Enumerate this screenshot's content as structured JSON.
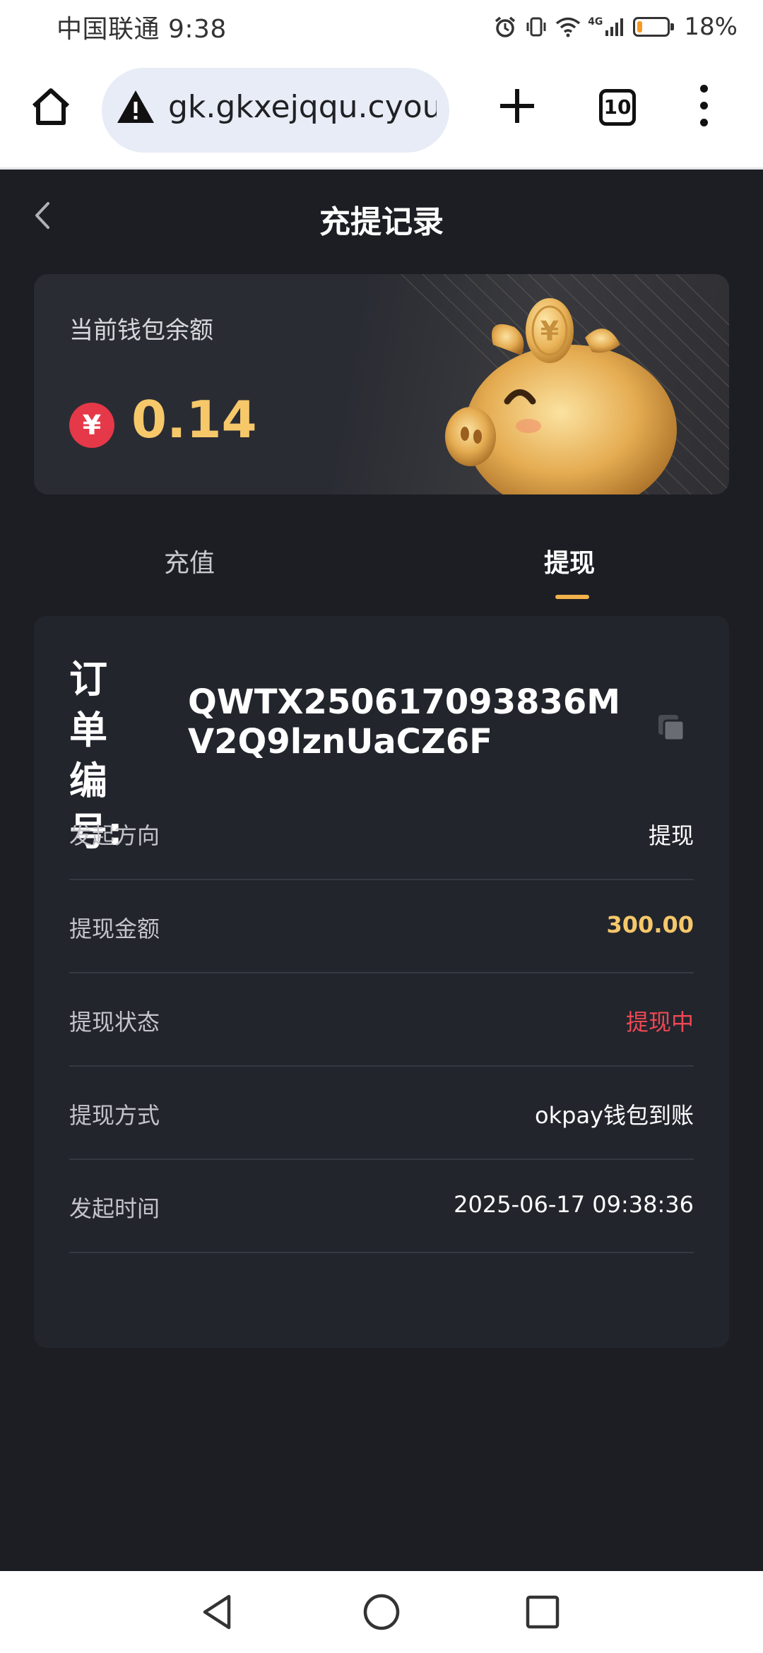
{
  "status_bar": {
    "carrier_time": "中国联通 9:38",
    "network": "4G",
    "battery_percent": "18%",
    "battery_level": 0.18,
    "battery_color": "#f59a23"
  },
  "browser": {
    "url": "gk.gkxejqqu.cyou",
    "tab_count": "10"
  },
  "header": {
    "title": "充提记录"
  },
  "wallet": {
    "label": "当前钱包余额",
    "currency_symbol": "¥",
    "balance": "0.14",
    "accent_color": "#f6c86a"
  },
  "tabs": [
    {
      "label": "充值",
      "active": false
    },
    {
      "label": "提现",
      "active": true
    }
  ],
  "order": {
    "number_label": "订单编号:",
    "number": "QWTX250617093836MV2Q9lznUaCZ6F",
    "details": [
      {
        "label": "发起方向",
        "value": "提现"
      },
      {
        "label": "提现金额",
        "value": "300.00"
      },
      {
        "label": "提现状态",
        "value": "提现中"
      },
      {
        "label": "提现方式",
        "value": "okpay钱包到账"
      },
      {
        "label": "发起时间",
        "value": "2025-06-17 09:38:36"
      }
    ]
  },
  "colors": {
    "background": "#1c1e24",
    "card": "#23252d",
    "status_red": "#ee4854",
    "tab_indicator": "#f2b24b"
  }
}
